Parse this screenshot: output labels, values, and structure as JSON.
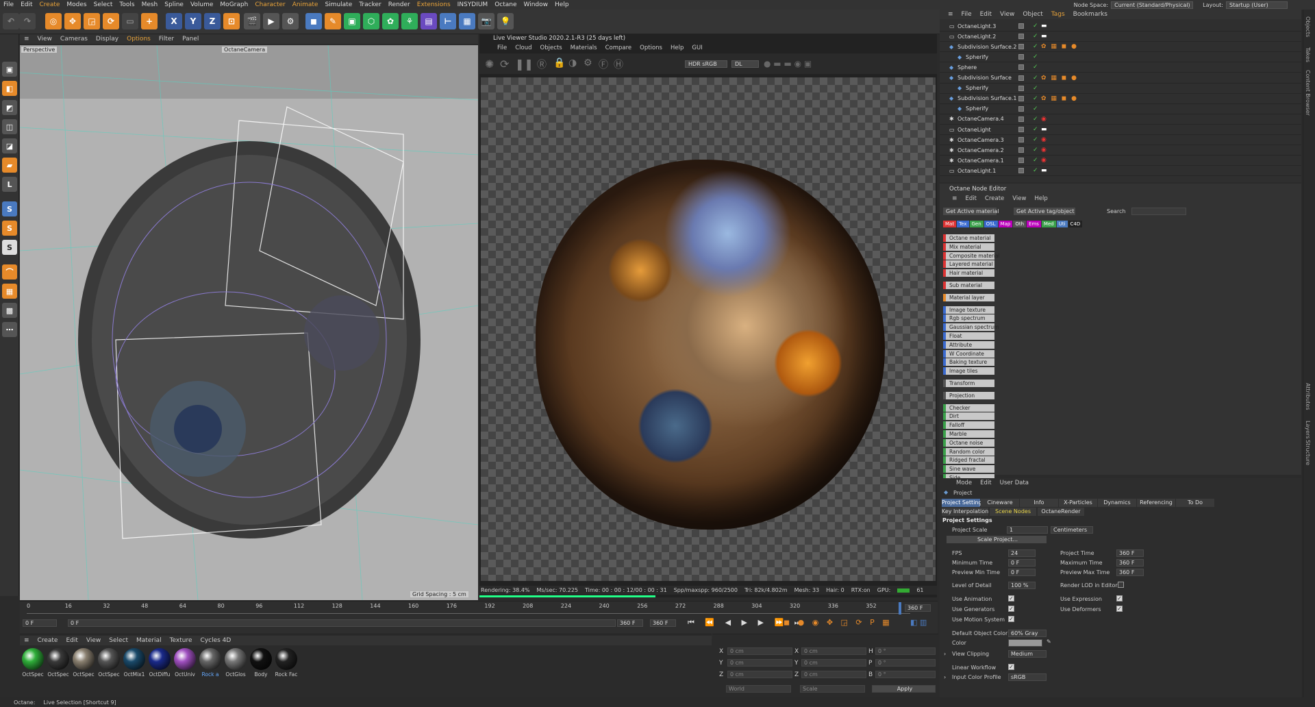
{
  "menubar": {
    "items": [
      "File",
      "Edit",
      "Create",
      "Modes",
      "Select",
      "Tools",
      "Mesh",
      "Spline",
      "Volume",
      "MoGraph",
      "Character",
      "Animate",
      "Simulate",
      "Tracker",
      "Render",
      "Extensions",
      "INSYDIUM",
      "Octane",
      "Window",
      "Help"
    ],
    "nodespace_label": "Node Space:",
    "nodespace_value": "Current (Standard/Physical)",
    "layout_label": "Layout:",
    "layout_value": "Startup (User)"
  },
  "toolbar": {
    "axis_x": "X",
    "axis_y": "Y",
    "axis_z": "Z"
  },
  "viewport": {
    "menu": [
      "View",
      "Cameras",
      "Display",
      "Options",
      "Filter",
      "Panel"
    ],
    "label": "Perspective",
    "camera": "OctaneCamera",
    "grid_spacing": "Grid Spacing : 5 cm"
  },
  "live_viewer": {
    "title": "Live Viewer Studio 2020.2.1-R3 (25 days left)",
    "menu": [
      "File",
      "Cloud",
      "Objects",
      "Materials",
      "Compare",
      "Options",
      "Help",
      "GUI"
    ],
    "color_mode": "HDR sRGB",
    "kernel": "DL",
    "status": {
      "rendering": "Rendering: 38.4%",
      "mssec": "Ms/sec: 70.225",
      "time": "Time: 00 : 00 : 12/00 : 00 : 31",
      "spp": "Spp/maxspp: 960/2500",
      "tri": "Tri: 82k/4.802m",
      "mesh": "Mesh: 33",
      "hair": "Hair: 0",
      "rtx": "RTX:on",
      "gpu": "GPU:",
      "gpu_val": "61"
    },
    "progress": 0.384
  },
  "timeline": {
    "ticks": [
      "0",
      "16",
      "32",
      "48",
      "64",
      "80",
      "96",
      "112",
      "128",
      "144",
      "160",
      "176",
      "192",
      "208",
      "224",
      "240",
      "256",
      "272",
      "288",
      "304",
      "320",
      "336",
      "352"
    ],
    "current": "360 F",
    "start": "0 F",
    "start2": "0 F",
    "end": "360 F",
    "end2": "360 F"
  },
  "materials": {
    "menu": [
      "Create",
      "Edit",
      "View",
      "Select",
      "Material",
      "Texture",
      "Cycles 4D"
    ],
    "items": [
      {
        "name": "OctSpec",
        "color": "#2fae3a"
      },
      {
        "name": "OctSpec",
        "color": "#3a3a3a"
      },
      {
        "name": "OctSpec",
        "color": "#8a8070"
      },
      {
        "name": "OctSpec",
        "color": "#555"
      },
      {
        "name": "OctMix1",
        "color": "#1a4a6a"
      },
      {
        "name": "OctDiffu",
        "color": "#1a2a8a"
      },
      {
        "name": "OctUniv",
        "color": "#a050c0"
      },
      {
        "name": "Rock a",
        "color": "#666"
      },
      {
        "name": "OctGlos",
        "color": "#777"
      },
      {
        "name": "Body",
        "color": "#111"
      },
      {
        "name": "Rock Fac",
        "color": "#222"
      }
    ]
  },
  "coords": {
    "x": "X",
    "y": "Y",
    "z": "Z",
    "h": "H",
    "p": "P",
    "b": "B",
    "val": "0 cm",
    "ang": "0 °",
    "world": "World",
    "scale": "Scale",
    "apply": "Apply"
  },
  "status": {
    "octane": "Octane:",
    "hint": "Live Selection [Shortcut 9]"
  },
  "objects": {
    "menu": [
      "File",
      "Edit",
      "View",
      "Object",
      "Tags",
      "Bookmarks"
    ],
    "rows": [
      "OctaneLight.3",
      "OctaneLight.2",
      "Subdivision Surface.2",
      "Spherify",
      "Sphere",
      "Subdivision Surface",
      "Spherify",
      "Subdivision Surface.1",
      "Spherify",
      "OctaneCamera.4",
      "OctaneLight",
      "OctaneCamera.3",
      "OctaneCamera.2",
      "OctaneCamera.1",
      "OctaneLight.1"
    ]
  },
  "node_editor": {
    "title": "Octane Node Editor",
    "menu": [
      "Edit",
      "Create",
      "View",
      "Help"
    ],
    "btn_material": "Get Active material",
    "btn_tag": "Get Active tag/object",
    "search": "Search",
    "cats": [
      "Mat",
      "Tex",
      "Gen",
      "OSL",
      "Map",
      "Oth",
      "Ems",
      "Med",
      "Uti",
      "C4D"
    ],
    "nodes": [
      {
        "name": "Octane material",
        "c": "#d33"
      },
      {
        "name": "Mix material",
        "c": "#d33"
      },
      {
        "name": "Composite material",
        "c": "#d33"
      },
      {
        "name": "Layered material",
        "c": "#d33"
      },
      {
        "name": "Hair material",
        "c": "#d33"
      },
      {
        "name": "Sub material",
        "c": "#d33"
      },
      {
        "name": "Material layer",
        "c": "#e68a2a"
      },
      {
        "name": "Image texture",
        "c": "#3a6ad0"
      },
      {
        "name": "Rgb spectrum",
        "c": "#3a6ad0"
      },
      {
        "name": "Gaussian spectrum",
        "c": "#3a6ad0"
      },
      {
        "name": "Float",
        "c": "#3a6ad0"
      },
      {
        "name": "Attribute",
        "c": "#3a6ad0"
      },
      {
        "name": "W Coordinate",
        "c": "#3a6ad0"
      },
      {
        "name": "Baking texture",
        "c": "#3a6ad0"
      },
      {
        "name": "Image tiles",
        "c": "#3a6ad0"
      },
      {
        "name": "Transform",
        "c": "#555"
      },
      {
        "name": "Projection",
        "c": "#555"
      },
      {
        "name": "Checker",
        "c": "#3aa04a"
      },
      {
        "name": "Dirt",
        "c": "#3aa04a"
      },
      {
        "name": "Falloff",
        "c": "#3aa04a"
      },
      {
        "name": "Marble",
        "c": "#3aa04a"
      },
      {
        "name": "Octane noise",
        "c": "#3aa04a"
      },
      {
        "name": "Random color",
        "c": "#3aa04a"
      },
      {
        "name": "Ridged fractal",
        "c": "#3aa04a"
      },
      {
        "name": "Sine wave",
        "c": "#3aa04a"
      },
      {
        "name": "Side",
        "c": "#3aa04a"
      }
    ]
  },
  "attributes": {
    "menu": [
      "Mode",
      "Edit",
      "User Data"
    ],
    "object": "Project",
    "tabs": [
      "Project Settings",
      "Cineware",
      "Info",
      "X-Particles",
      "Dynamics",
      "Referencing",
      "To Do"
    ],
    "tabs2": [
      "Key Interpolation",
      "Scene Nodes",
      "OctaneRender"
    ],
    "section": "Project Settings",
    "project_scale": "Project Scale",
    "scale_val": "1",
    "scale_unit": "Centimeters",
    "scale_btn": "Scale Project...",
    "fps": "FPS",
    "fps_val": "24",
    "min_time": "Minimum Time",
    "min_val": "0 F",
    "prev_min": "Preview Min Time",
    "prev_min_val": "0 F",
    "proj_time": "Project Time",
    "proj_time_val": "360 F",
    "max_time": "Maximum Time",
    "max_val": "360 F",
    "prev_max": "Preview Max Time",
    "prev_max_val": "360 F",
    "lod": "Level of Detail",
    "lod_val": "100 %",
    "render_lod": "Render LOD in Editor",
    "use_anim": "Use Animation",
    "use_expr": "Use Expression",
    "use_gen": "Use Generators",
    "use_def": "Use Deformers",
    "use_motion": "Use Motion System",
    "default_color": "Default Object Color",
    "default_color_val": "60% Gray",
    "color": "Color",
    "view_clip": "View Clipping",
    "view_clip_val": "Medium",
    "linear": "Linear Workflow",
    "input_profile": "Input Color Profile",
    "input_profile_val": "sRGB"
  },
  "right_strip": [
    "Objects",
    "Takes",
    "Content Browser",
    "Attributes",
    "Layers",
    "Structure"
  ]
}
